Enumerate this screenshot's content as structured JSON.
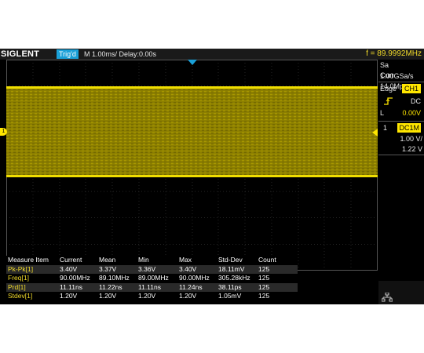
{
  "topbar": {
    "logo": "SIGLENT",
    "trigger_status": "Trig'd",
    "timebase": "M 1.00ms/ Delay:0.00s",
    "frequency": "f = 89.9992MHz"
  },
  "channel_marker": "1",
  "right_panel": {
    "sample_rate": "Sa 1.00GSa/s",
    "memory_depth": "Curr 14.0Mpts",
    "trigger_type": "Edge",
    "trigger_source": "CH1",
    "trigger_coupling": "DC",
    "trigger_level_label": "L",
    "trigger_level": "0.00V",
    "channel_number": "1",
    "channel_coupling": "DC1M",
    "volts_per_div": "1.00 V/",
    "offset": "1.22 V"
  },
  "measure_table": {
    "headers": [
      "Measure Item",
      "Current",
      "Mean",
      "Min",
      "Max",
      "Std-Dev",
      "Count"
    ],
    "rows": [
      [
        "Pk-Pk[1]",
        "3.40V",
        "3.37V",
        "3.36V",
        "3.40V",
        "18.11mV",
        "125"
      ],
      [
        "Freq[1]",
        "90.00MHz",
        "89.10MHz",
        "89.00MHz",
        "90.00MHz",
        "305.28kHz",
        "125"
      ],
      [
        "Prd[1]",
        "11.11ns",
        "11.22ns",
        "11.11ns",
        "11.24ns",
        "38.11ps",
        "125"
      ],
      [
        "Stdev[1]",
        "1.20V",
        "1.20V",
        "1.20V",
        "1.20V",
        "1.05mV",
        "125"
      ]
    ]
  },
  "colors": {
    "trace": "#c8b400",
    "accent_blue": "#1aa0d8",
    "measure_item": "#f3dc2a",
    "badge": "#ffe600"
  }
}
